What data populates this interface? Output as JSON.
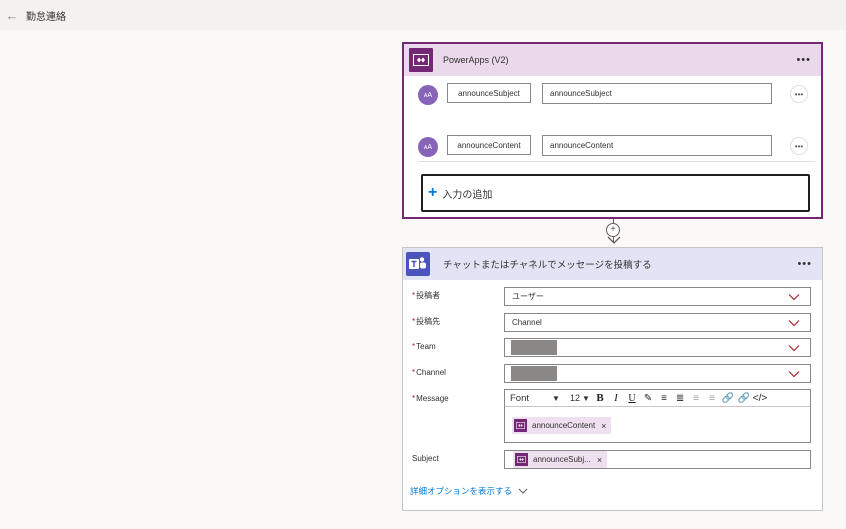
{
  "topbar": {
    "title": "勤怠連絡"
  },
  "powerapps_card": {
    "title": "PowerApps (V2)",
    "inputs": [
      {
        "avatar": "ᴀA",
        "name": "announceSubject",
        "value": "announceSubject"
      },
      {
        "avatar": "ᴀA",
        "name": "announceContent",
        "value": "announceContent"
      }
    ],
    "add_input_label": "入力の追加"
  },
  "teams_card": {
    "title": "チャットまたはチャネルでメッセージを投稿する",
    "fields": {
      "poster": {
        "label": "投稿者",
        "value": "ユーザー"
      },
      "post_to": {
        "label": "投稿先",
        "value": "Channel"
      },
      "team": {
        "label": "Team"
      },
      "channel": {
        "label": "Channel"
      },
      "message": {
        "label": "Message",
        "toolbar": {
          "font": "Font",
          "size": "12"
        },
        "token": "announceContent"
      },
      "subject": {
        "label": "Subject",
        "token": "announceSubj..."
      }
    },
    "advanced_options": "詳細オプションを表示する"
  },
  "colors": {
    "powerapps": "#742774",
    "teams": "#4b53bc",
    "link": "#0078d4",
    "required": "#a4262c"
  }
}
